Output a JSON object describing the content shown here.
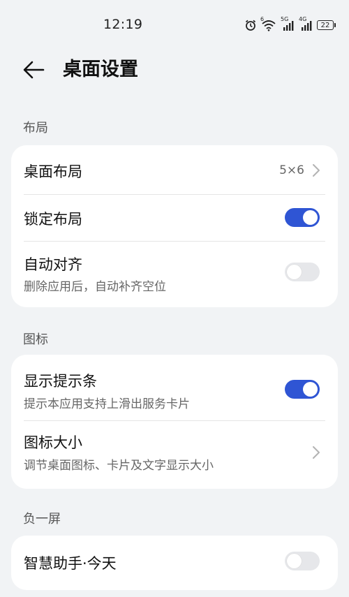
{
  "status_bar": {
    "time": "12:19",
    "icons": [
      "alarm-icon",
      "wifi-icon",
      "signal-5g-icon",
      "signal-4g-icon",
      "battery-icon"
    ],
    "network_1": "5G",
    "network_2": "4G",
    "wifi_badge": "6",
    "battery": "22"
  },
  "header": {
    "title": "桌面设置"
  },
  "sections": [
    {
      "title": "布局",
      "rows": [
        {
          "title": "桌面布局",
          "value": "5×6",
          "control": "chevron"
        },
        {
          "title": "锁定布局",
          "control": "toggle",
          "state": "on"
        },
        {
          "title": "自动对齐",
          "subtitle": "删除应用后，自动补齐空位",
          "control": "toggle",
          "state": "off"
        }
      ]
    },
    {
      "title": "图标",
      "rows": [
        {
          "title": "显示提示条",
          "subtitle": "提示本应用支持上滑出服务卡片",
          "control": "toggle",
          "state": "on"
        },
        {
          "title": "图标大小",
          "subtitle": "调节桌面图标、卡片及文字显示大小",
          "control": "chevron"
        }
      ]
    },
    {
      "title": "负一屏",
      "rows": [
        {
          "title": "智慧助手·今天",
          "control": "toggle",
          "state": "off"
        }
      ]
    }
  ],
  "colors": {
    "background": "#f1f3f5",
    "card": "#ffffff",
    "toggle_on": "#2f55d4",
    "toggle_off": "#e6e7ea"
  }
}
